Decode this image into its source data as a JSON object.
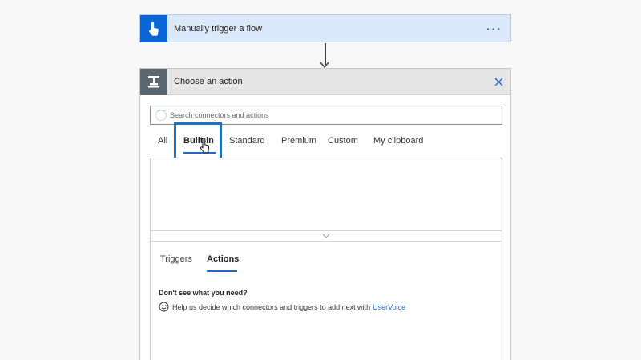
{
  "trigger": {
    "title": "Manually trigger a flow",
    "more": "···"
  },
  "action": {
    "title": "Choose an action",
    "search": {
      "placeholder": "Search connectors and actions"
    },
    "tabs": [
      "All",
      "Built-in",
      "Standard",
      "Premium",
      "Custom",
      "My clipboard"
    ],
    "selected_tab": "Built-in",
    "subtabs": [
      "Triggers",
      "Actions"
    ],
    "selected_subtab": "Actions",
    "dont_see": "Don't see what you need?",
    "help_text": "Help us decide which connectors and triggers to add next with",
    "help_link": "UserVoice"
  },
  "colors": {
    "accent": "#2266cc",
    "trigger_bg": "#dce9fb",
    "trigger_icon": "#0a66d8",
    "action_icon": "#5a6670"
  },
  "icons": {
    "trigger": "hand-touch-icon",
    "action": "action-icon",
    "close": "close-icon",
    "more": "more-icon",
    "expand": "chevron-down-icon",
    "feedback": "smile-icon"
  }
}
